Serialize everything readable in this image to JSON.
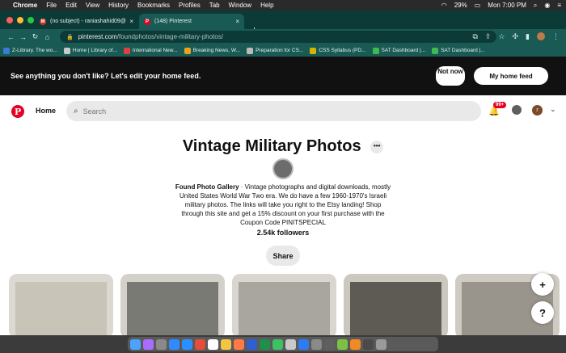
{
  "menubar": {
    "items": [
      "Chrome",
      "File",
      "Edit",
      "View",
      "History",
      "Bookmarks",
      "Profiles",
      "Tab",
      "Window",
      "Help"
    ],
    "battery": "29%",
    "clock": "Mon 7:00 PM"
  },
  "tabs": [
    {
      "label": "(no subject) - raniashahid09@",
      "favicon": "gmail-icon",
      "color": "#d93025"
    },
    {
      "label": "(148) Pinterest",
      "favicon": "pinterest-icon",
      "color": "#e60023"
    }
  ],
  "address": {
    "domain": "pinterest.com",
    "path": "/foundphotos/vintage-military-photos/"
  },
  "bookmarks": [
    {
      "label": "Z-Library. The wo...",
      "color": "#3a7bd5"
    },
    {
      "label": "Home | Library of...",
      "color": "#c9c9c9"
    },
    {
      "label": "International New...",
      "color": "#e04040"
    },
    {
      "label": "Breaking News, W...",
      "color": "#f0a020"
    },
    {
      "label": "Preparation for CS...",
      "color": "#bbbbbb"
    },
    {
      "label": "CSS Syllabus (PD...",
      "color": "#d7b400"
    },
    {
      "label": "SAT Dashboard |...",
      "color": "#3fb950"
    },
    {
      "label": "SAT Dashboard |...",
      "color": "#3fb950"
    }
  ],
  "banner": {
    "text": "See anything you don't like? Let's edit your home feed.",
    "not_now": "Not now",
    "edit": "My home feed"
  },
  "header": {
    "home": "Home",
    "search_placeholder": "Search",
    "badge": "99+",
    "avatar_letter": "r"
  },
  "board": {
    "title": "Vintage Military Photos",
    "owner": "Found Photo Gallery",
    "description": " · Vintage photographs and digital downloads, mostly United States World War Two era. We do have a few 1960-1970's Israeli military photos. The links will take you right to the Etsy landing! Shop through this site and get a 15% discount on your first purchase with the Coupon Code PINITSPECIAL",
    "followers": "2.54k followers",
    "share": "Share"
  },
  "accent": "#e60023"
}
